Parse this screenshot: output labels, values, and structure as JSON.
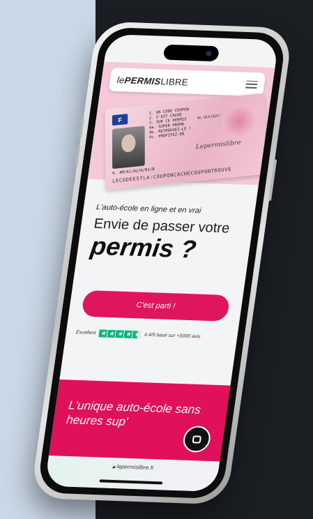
{
  "header": {
    "logo_le": "le",
    "logo_permis": "PERMIS",
    "logo_libre": "LIBRE"
  },
  "license": {
    "flag": "F",
    "lines": [
      "1. UN CODE COUPON",
      "2. S'EST CACHÉ",
      "3. SUR CE PERMIS",
      "4a. SUPER PROMO",
      "4b. RETROUVEZ-LE !",
      "4c. PROFITEZ-EN"
    ],
    "ok_text": "4c. OUI OUI !",
    "signature": "Lepermislibre",
    "mrz1": "9. AM/A1/A2/A/B1/B",
    "mrz2": "LECODEESTLA:COUPONCACHECOUPONTROUVE"
  },
  "hero": {
    "tagline": "L'auto-école en ligne et en vrai",
    "headline": "Envie de passer votre",
    "headline_bold": "permis ?"
  },
  "cta": {
    "label": "C'est parti !"
  },
  "rating": {
    "label": "Excellent",
    "text": "4.4/5 basé sur +5000 avis",
    "stars": 4.4
  },
  "promo": {
    "text": "L'unique auto-école sans heures sup'"
  },
  "browser": {
    "url": "lepermislibre.fr"
  },
  "colors": {
    "accent": "#e0155f",
    "pink_bg": "#f5c9d9",
    "trustpilot": "#00b67a",
    "left_bg": "#c9d7e6",
    "right_bg": "#1b1f24"
  },
  "icons": {
    "menu": "hamburger-menu-icon",
    "chat": "chat-icon",
    "lock": "lock-icon",
    "star": "trustpilot-star-icon"
  }
}
